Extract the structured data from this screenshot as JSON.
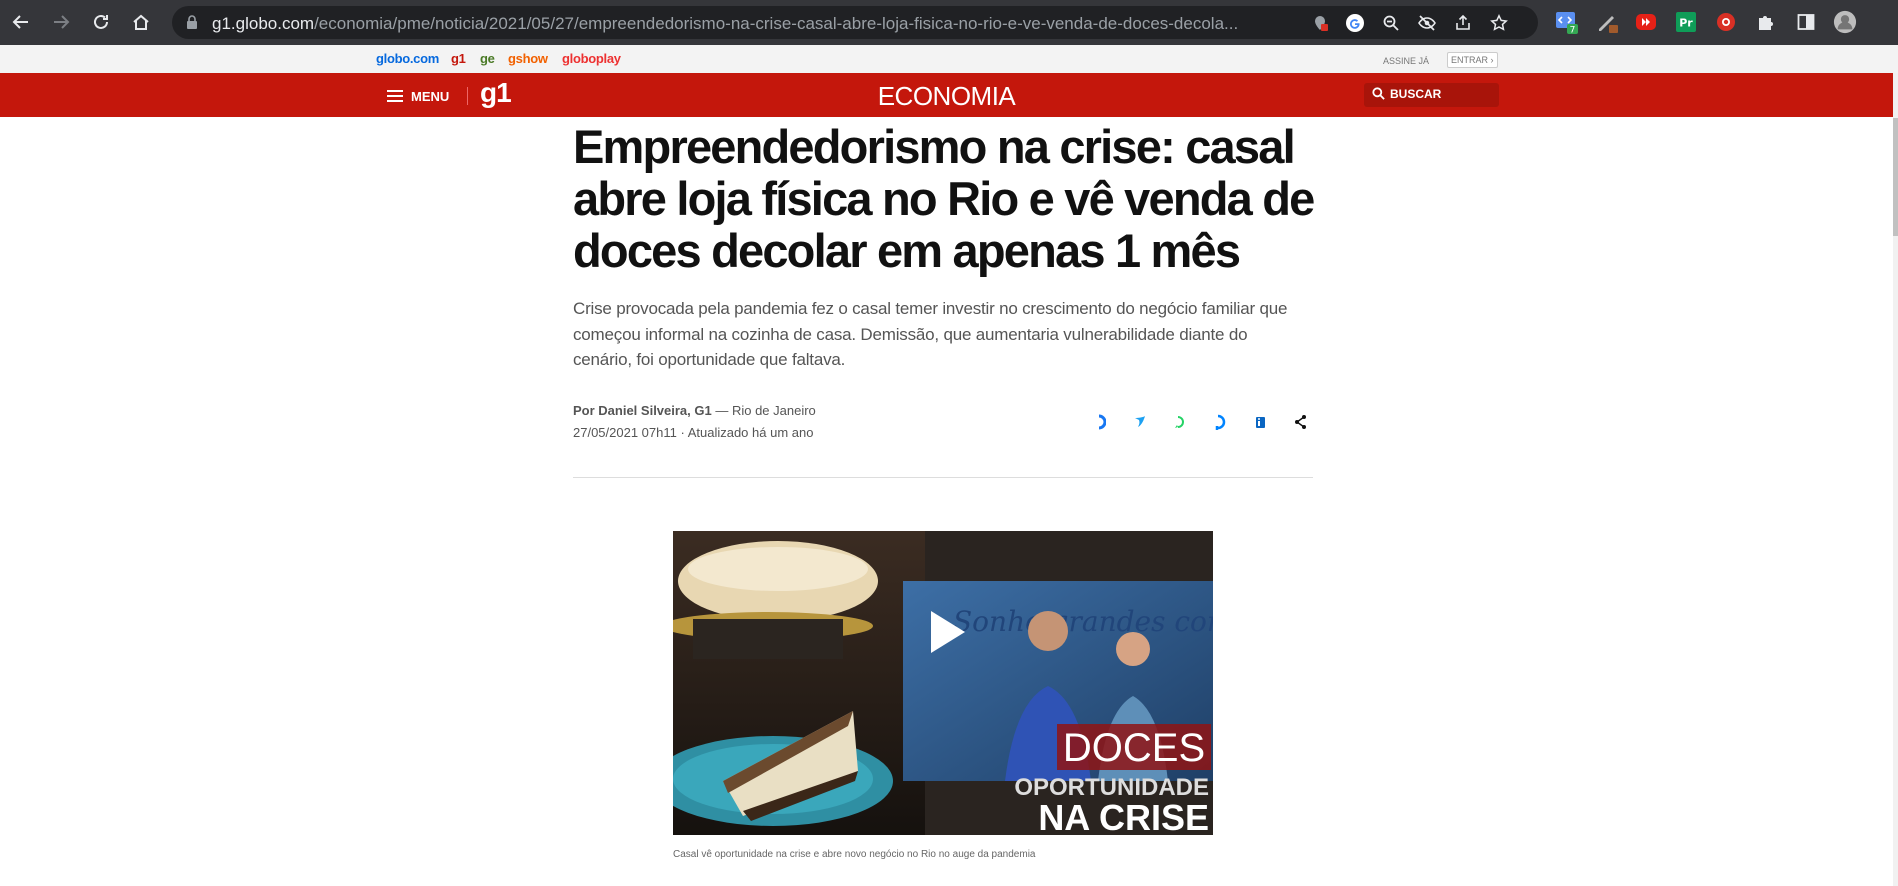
{
  "browser": {
    "url_host": "g1.globo.com",
    "url_path": "/economia/pme/noticia/2021/05/27/empreendedorismo-na-crise-casal-abre-loja-fisica-no-rio-e-ve-venda-de-doces-decola...",
    "extension_badge": "7"
  },
  "globobar": {
    "links": [
      "globo.com",
      "g1",
      "ge",
      "gshow",
      "globoplay"
    ],
    "link_colors": [
      "#0669de",
      "#c4170c",
      "#4a7a26",
      "#f26100",
      "#ed3131"
    ],
    "subscribe": "ASSINE JÁ",
    "login": "ENTRAR ›"
  },
  "header": {
    "menu_label": "MENU",
    "logo": "g1",
    "section": "ECONOMIA",
    "search_label": "BUSCAR",
    "brand_color": "#c4170c"
  },
  "article": {
    "title": "Empreendedorismo na crise: casal abre loja física no Rio e vê venda de doces decolar em apenas 1 mês",
    "subtitle": "Crise provocada pela pandemia fez o casal temer investir no crescimento do negócio familiar que começou informal na cozinha de casa. Demissão, que aumentaria vulnerabilidade diante do cenário, foi oportunidade que faltava.",
    "author": "Por Daniel Silveira, G1",
    "location": " — Rio de Janeiro",
    "date": "27/05/2021 07h11 · Atualizado há um ano",
    "share_icons": [
      "facebook-icon",
      "twitter-icon",
      "whatsapp-icon",
      "messenger-icon",
      "linkedin-icon",
      "share-icon"
    ],
    "video": {
      "overlay_tag": "DOCES",
      "overlay_line1": "OPORTUNIDADE",
      "overlay_line2": "NA CRISE",
      "wall_text": "Sonhe grandes com pequ..."
    },
    "caption": "Casal vê oportunidade na crise e abre novo negócio no Rio no auge da pandemia"
  }
}
